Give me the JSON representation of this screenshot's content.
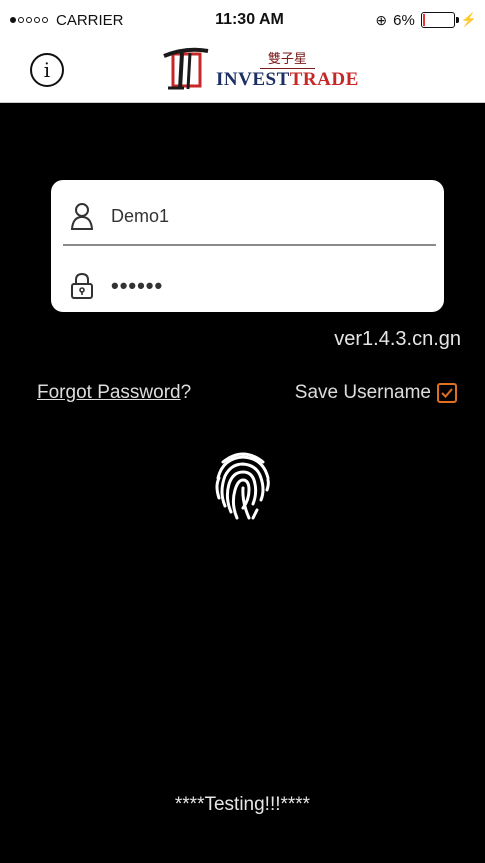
{
  "status_bar": {
    "carrier": "CARRIER",
    "time": "11:30 AM",
    "battery_text": "6%",
    "battery_level": 0.06,
    "battery_color": "#e53935"
  },
  "header": {
    "info_icon": "info-icon",
    "logo_cn": "雙子星",
    "logo_en_part1": "INVEST",
    "logo_en_part2": "TRADE"
  },
  "login": {
    "username_icon": "user-icon",
    "username_value": "Demo1",
    "password_icon": "lock-icon",
    "password_value": "••••••"
  },
  "version": "ver1.4.3.cn.gn",
  "options": {
    "forgot_link": "Forgot Password",
    "forgot_suffix": "?",
    "save_username_label": "Save Username",
    "save_username_checked": true,
    "accent_color": "#e07020"
  },
  "fingerprint_icon": "fingerprint-icon",
  "footer_text": "****Testing!!!****"
}
